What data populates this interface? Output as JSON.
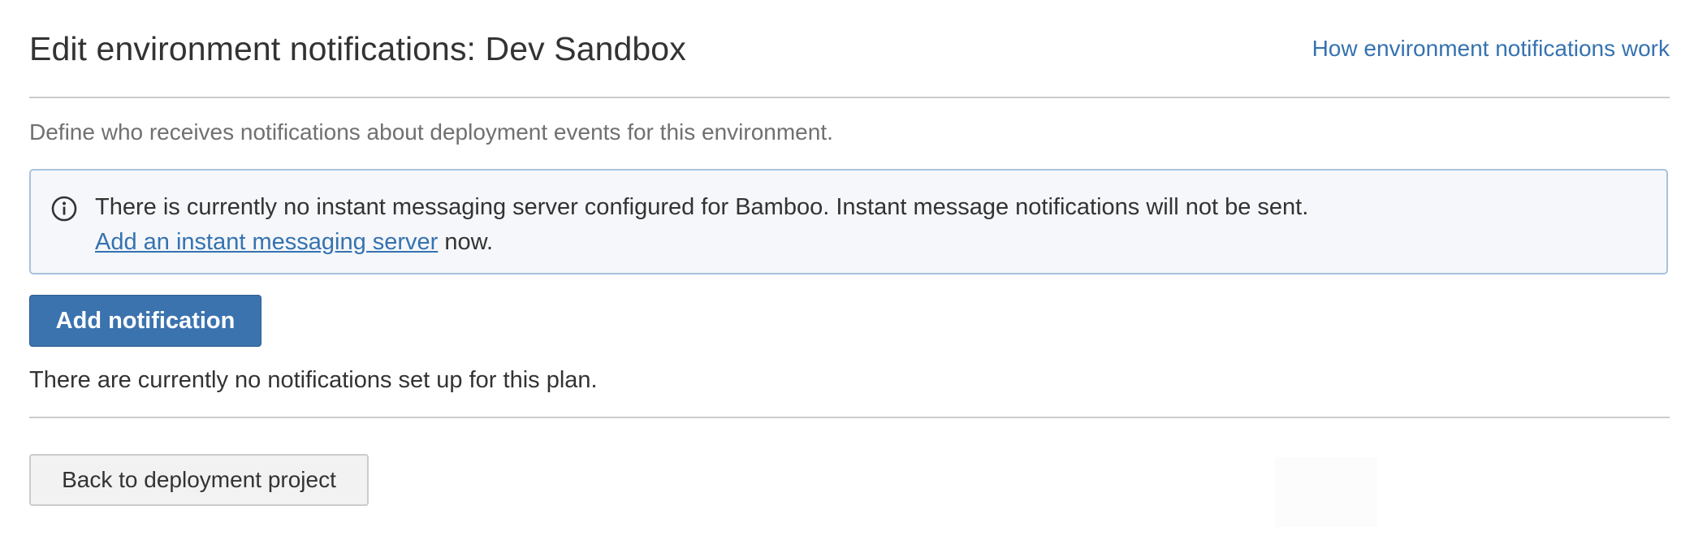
{
  "header": {
    "title": "Edit environment notifications: Dev Sandbox",
    "help_link": "How environment notifications work"
  },
  "description": "Define who receives notifications about deployment events for this environment.",
  "info_message": {
    "icon": "info-icon",
    "text": "There is currently no instant messaging server configured for Bamboo. Instant message notifications will not be sent.",
    "link_text": "Add an instant messaging server",
    "suffix": " now."
  },
  "actions": {
    "add_notification_label": "Add notification",
    "back_label": "Back to deployment project"
  },
  "empty_message": "There are currently no notifications set up for this plan.",
  "colors": {
    "primary_button": "#3b73af",
    "link": "#3572b0",
    "info_border": "#a9c2dc",
    "info_background": "#f5f7fa"
  }
}
